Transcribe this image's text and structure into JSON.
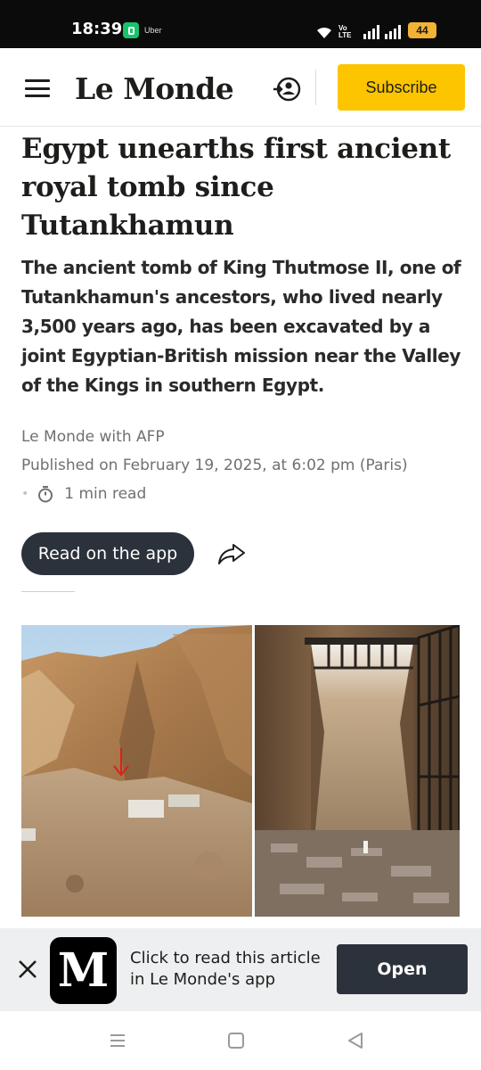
{
  "status_bar": {
    "time": "18:39",
    "notification_app": "Uber",
    "network": "Vo LTE",
    "battery": "44"
  },
  "header": {
    "logo": "Le Monde",
    "subscribe_label": "Subscribe"
  },
  "article": {
    "title": "Egypt unearths first ancient royal tomb since Tutankhamun",
    "lede": "The ancient tomb of King Thutmose II, one of Tutankhamun's ancestors, who lived nearly 3,500 years ago, has been excavated by a joint Egyptian-British mission near the Valley of the Kings in southern Egypt.",
    "author": "Le Monde with AFP",
    "published": "Published on February 19, 2025, at 6:02 pm (Paris)",
    "read_time": "1 min read",
    "read_on_app_label": "Read on the app"
  },
  "app_banner": {
    "logo_letter": "M",
    "text": "Click to read this article in Le Monde's app",
    "open_label": "Open"
  },
  "colors": {
    "accent_yellow": "#fcc500",
    "dark_button": "#2c323b",
    "banner_bg": "#eeeff1"
  }
}
